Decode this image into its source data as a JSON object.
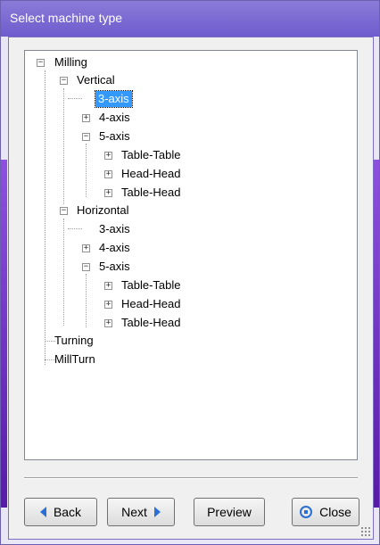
{
  "window": {
    "title": "Select machine type"
  },
  "tree": {
    "selected": "3-axis",
    "nodes": {
      "milling": "Milling",
      "vertical": "Vertical",
      "v_3axis": "3-axis",
      "v_4axis": "4-axis",
      "v_5axis": "5-axis",
      "v_table_table": "Table-Table",
      "v_head_head": "Head-Head",
      "v_table_head": "Table-Head",
      "horizontal": "Horizontal",
      "h_3axis": "3-axis",
      "h_4axis": "4-axis",
      "h_5axis": "5-axis",
      "h_table_table": "Table-Table",
      "h_head_head": "Head-Head",
      "h_table_head": "Table-Head",
      "turning": "Turning",
      "millturn": "MillTurn"
    },
    "expand_symbols": {
      "collapse": "−",
      "expand": "+"
    }
  },
  "buttons": {
    "back": "Back",
    "next": "Next",
    "preview": "Preview",
    "close": "Close"
  }
}
